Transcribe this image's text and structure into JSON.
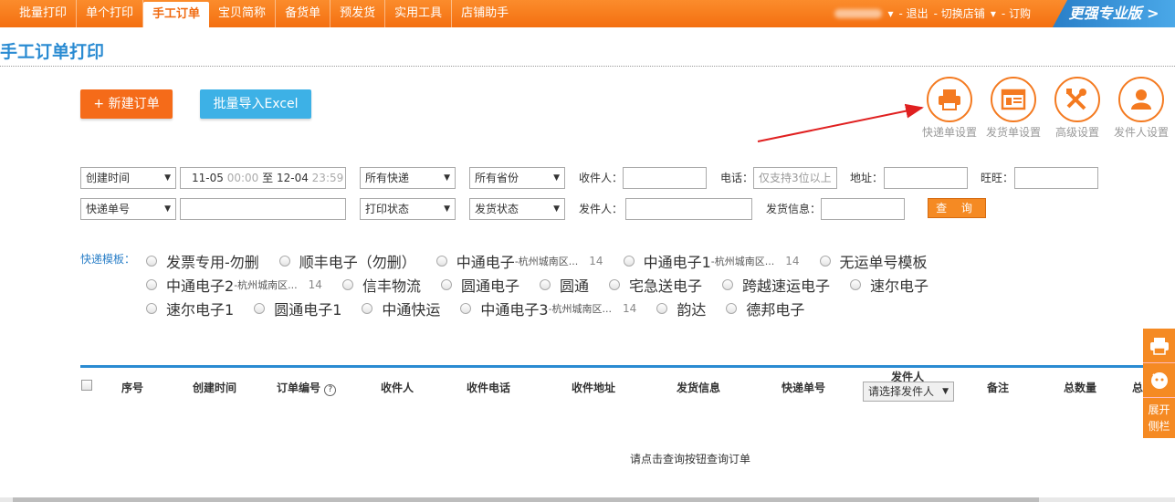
{
  "nav": {
    "items": [
      "批量打印",
      "单个打印",
      "手工订单",
      "宝贝简称",
      "备货单",
      "预发货",
      "实用工具",
      "店铺助手"
    ],
    "active": "手工订单"
  },
  "userbar": {
    "logout": "- 退出",
    "switch": "- 切换店铺",
    "order": "- 订购"
  },
  "pro_banner": "更强专业版 >",
  "page_title": "手工订单打印",
  "actions": {
    "new_order": "+ 新建订单",
    "import_excel": "批量导入Excel"
  },
  "tools": [
    {
      "label": "快递单设置",
      "icon": "printer-icon"
    },
    {
      "label": "发货单设置",
      "icon": "invoice-icon"
    },
    {
      "label": "高级设置",
      "icon": "tools-icon"
    },
    {
      "label": "发件人设置",
      "icon": "user-icon"
    }
  ],
  "filters": {
    "date_type": "创建时间",
    "date_from": "11-05",
    "time_from": "00:00",
    "date_sep": "至",
    "date_to": "12-04",
    "time_to": "23:59",
    "express": "所有快递",
    "province": "所有省份",
    "receiver_label": "收件人：",
    "phone_label": "电话：",
    "phone_placeholder": "仅支持3位以上",
    "address_label": "地址：",
    "wangwang_label": "旺旺：",
    "number_type": "快递单号",
    "print_status": "打印状态",
    "ship_status": "发货状态",
    "sender_label": "发件人：",
    "ship_info_label": "发货信息：",
    "query_button": "查 询"
  },
  "templates": {
    "label": "快递模板：",
    "rows": [
      [
        {
          "name": "发票专用-勿删"
        },
        {
          "name": "顺丰电子（勿删）"
        },
        {
          "name": "中通电子",
          "sub": "-杭州城南区...",
          "count": "14"
        },
        {
          "name": "中通电子1",
          "sub": "-杭州城南区...",
          "count": "14"
        },
        {
          "name": "无运单号模板"
        }
      ],
      [
        {
          "name": "中通电子2",
          "sub": "-杭州城南区...",
          "count": "14"
        },
        {
          "name": "信丰物流"
        },
        {
          "name": "圆通电子"
        },
        {
          "name": "圆通"
        },
        {
          "name": "宅急送电子"
        },
        {
          "name": "跨越速运电子"
        },
        {
          "name": "速尔电子"
        }
      ],
      [
        {
          "name": "速尔电子1"
        },
        {
          "name": "圆通电子1"
        },
        {
          "name": "中通快运"
        },
        {
          "name": "中通电子3",
          "sub": "-杭州城南区...",
          "count": "14"
        },
        {
          "name": "韵达"
        },
        {
          "name": "德邦电子"
        }
      ]
    ]
  },
  "table": {
    "headers": {
      "seq": "序号",
      "created": "创建时间",
      "order_no": "订单编号",
      "receiver": "收件人",
      "receiver_phone": "收件电话",
      "receiver_address": "收件地址",
      "ship_info": "发货信息",
      "tracking_no": "快递单号",
      "sender": "发件人",
      "remark": "备注",
      "total": "总数量",
      "cut": "总"
    },
    "sender_select": "请选择发件人",
    "empty_text": "请点击查询按钮查询订单"
  },
  "side": {
    "expand": "展开",
    "sidebar": "侧栏"
  },
  "colors": {
    "brand_orange": "#f46f10",
    "title_blue": "#2a8bd2",
    "excel_blue": "#3db1e6"
  }
}
